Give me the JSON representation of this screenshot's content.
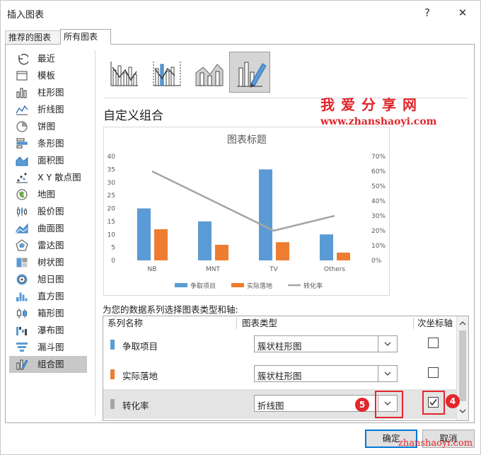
{
  "dialog": {
    "title": "插入图表",
    "help": "?",
    "close": "✕"
  },
  "tabs": [
    "推荐的图表",
    "所有图表"
  ],
  "sidebar": {
    "items": [
      {
        "label": "最近",
        "icon": "recent-icon"
      },
      {
        "label": "模板",
        "icon": "template-icon"
      },
      {
        "label": "柱形图",
        "icon": "column-chart-icon"
      },
      {
        "label": "折线图",
        "icon": "line-chart-icon"
      },
      {
        "label": "饼图",
        "icon": "pie-chart-icon"
      },
      {
        "label": "条形图",
        "icon": "bar-chart-icon"
      },
      {
        "label": "面积图",
        "icon": "area-chart-icon"
      },
      {
        "label": "X Y 散点图",
        "icon": "scatter-chart-icon"
      },
      {
        "label": "地图",
        "icon": "map-chart-icon"
      },
      {
        "label": "股价图",
        "icon": "stock-chart-icon"
      },
      {
        "label": "曲面图",
        "icon": "surface-chart-icon"
      },
      {
        "label": "雷达图",
        "icon": "radar-chart-icon"
      },
      {
        "label": "树状图",
        "icon": "treemap-chart-icon"
      },
      {
        "label": "旭日图",
        "icon": "sunburst-chart-icon"
      },
      {
        "label": "直方图",
        "icon": "histogram-chart-icon"
      },
      {
        "label": "箱形图",
        "icon": "box-whisker-chart-icon"
      },
      {
        "label": "瀑布图",
        "icon": "waterfall-chart-icon"
      },
      {
        "label": "漏斗图",
        "icon": "funnel-chart-icon"
      },
      {
        "label": "组合图",
        "icon": "combo-chart-icon"
      }
    ],
    "selected_index": 18
  },
  "subtypes": {
    "selected_index": 3,
    "icons": [
      "clustered-column-line-icon",
      "clustered-column-line-secondary-icon",
      "stacked-area-column-icon",
      "custom-combo-icon"
    ]
  },
  "section_title": "自定义组合",
  "watermark": {
    "cn": "我爱分享网",
    "url": "www.zhanshaoyi.com",
    "bottom": "zhanshaoyi.com"
  },
  "chart_data": {
    "type": "bar",
    "title": "图表标题",
    "categories": [
      "NB",
      "MNT",
      "TV",
      "Others"
    ],
    "series": [
      {
        "name": "争取项目",
        "type": "bar",
        "axis": "primary",
        "color": "#5b9bd5",
        "values": [
          20,
          15,
          35,
          10
        ]
      },
      {
        "name": "实际落地",
        "type": "bar",
        "axis": "primary",
        "color": "#ed7d31",
        "values": [
          12,
          6,
          7,
          3
        ]
      },
      {
        "name": "转化率",
        "type": "line",
        "axis": "secondary",
        "color": "#a5a5a5",
        "values": [
          0.6,
          0.4,
          0.2,
          0.3
        ]
      }
    ],
    "ylim": [
      0,
      40
    ],
    "yticks": [
      "0",
      "5",
      "10",
      "15",
      "20",
      "25",
      "30",
      "35",
      "40"
    ],
    "y2lim": [
      0,
      0.7
    ],
    "y2ticks": [
      "0%",
      "10%",
      "20%",
      "30%",
      "40%",
      "50%",
      "60%",
      "70%"
    ],
    "legend_position": "bottom",
    "grid": false
  },
  "instruction": "为您的数据系列选择图表类型和轴:",
  "grid": {
    "headers": {
      "name": "系列名称",
      "type": "图表类型",
      "secondary": "次坐标轴"
    },
    "rows": [
      {
        "name": "争取项目",
        "color": "#5b9bd5",
        "chart_type": "簇状柱形图",
        "secondary_axis": false
      },
      {
        "name": "实际落地",
        "color": "#ed7d31",
        "chart_type": "簇状柱形图",
        "secondary_axis": false
      },
      {
        "name": "转化率",
        "color": "#a5a5a5",
        "chart_type": "折线图",
        "secondary_axis": true
      }
    ]
  },
  "annotations": {
    "badge_dropdown": "5",
    "badge_checkbox": "4"
  },
  "buttons": {
    "ok": "确定",
    "cancel": "取消"
  }
}
